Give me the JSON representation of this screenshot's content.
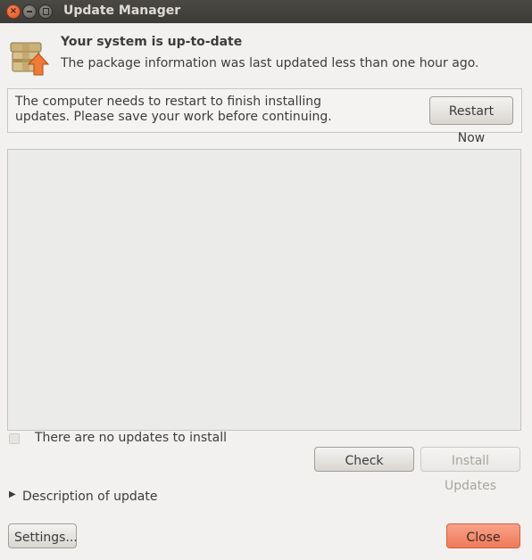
{
  "window": {
    "title": "Update Manager",
    "close_glyph": "×"
  },
  "header": {
    "icon": "package-update-icon",
    "title": "Your system is up-to-date",
    "subtitle": "The package information was last updated less than one hour ago."
  },
  "restart_panel": {
    "message": "The computer needs to restart to finish installing updates. Please save your work before continuing.",
    "restart_label": "Restart Now"
  },
  "status": {
    "text": "There are no updates to install",
    "checked": false
  },
  "actions": {
    "check_label": "Check",
    "install_label": "Install Updates",
    "install_enabled": false
  },
  "expander": {
    "label": "Description of update",
    "arrow": "▶",
    "expanded": false
  },
  "footer": {
    "settings_label": "Settings...",
    "close_label": "Close"
  },
  "colors": {
    "titlebar": "#3c3b37",
    "close_accent": "#ef7a5a",
    "window_bg": "#f2f1f0"
  }
}
